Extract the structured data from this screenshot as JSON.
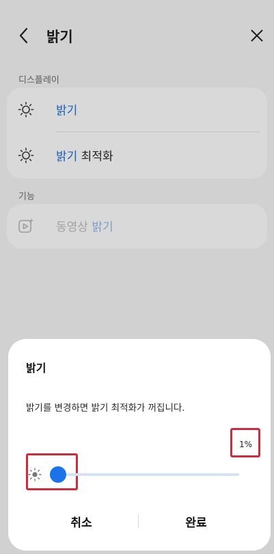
{
  "header": {
    "title": "밝기"
  },
  "sections": {
    "display_label": "디스플레이",
    "features_label": "기능"
  },
  "items": {
    "brightness": {
      "label": "밝기"
    },
    "adaptive": {
      "label_blue": "밝기",
      "label_rest": " 최적화"
    },
    "video": {
      "label_gray": "동영상 ",
      "label_blue": "밝기"
    }
  },
  "dialog": {
    "title": "밝기",
    "message": "밝기를 변경하면 밝기 최적화가 꺼집니다.",
    "percent": "1%",
    "brightness_value": 1,
    "cancel": "취소",
    "done": "완료"
  },
  "colors": {
    "accent": "#1a73e8",
    "highlight": "#cf2b3c"
  }
}
